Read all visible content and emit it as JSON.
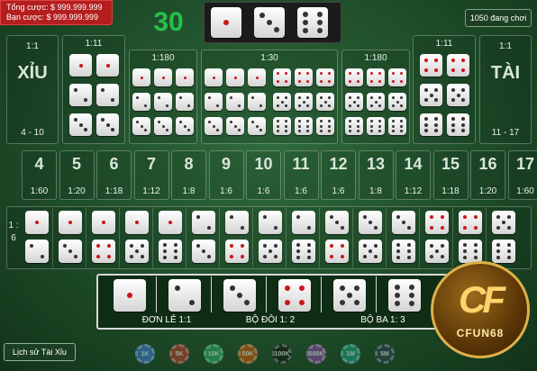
{
  "header": {
    "total_bet_label": "Tổng cược: $ 999.999.999",
    "your_bet_label": "Bạn cược: $ 999.999.999",
    "timer": "30",
    "online": "1050 đang chơi",
    "result_dice": [
      1,
      3,
      6
    ]
  },
  "xiu": {
    "ratio": "1:1",
    "label": "XỈU",
    "range": "4 - 10"
  },
  "tai": {
    "ratio": "1:1",
    "label": "TÀI",
    "range": "11 - 17"
  },
  "pairs_left": {
    "ratio": "1:11",
    "faces": [
      1,
      2,
      3
    ]
  },
  "pairs_right": {
    "ratio": "1:11",
    "faces": [
      4,
      5,
      6
    ]
  },
  "triples_left": {
    "ratio": "1:180",
    "faces": [
      1,
      2,
      3
    ]
  },
  "triples_right": {
    "ratio": "1:180",
    "faces": [
      4,
      5,
      6
    ]
  },
  "any_triple": {
    "ratio": "1:30",
    "faces": [
      1,
      2,
      3,
      4,
      5,
      6
    ]
  },
  "sums": [
    {
      "n": "4",
      "r": "1:60"
    },
    {
      "n": "5",
      "r": "1:20"
    },
    {
      "n": "6",
      "r": "1:18"
    },
    {
      "n": "7",
      "r": "1:12"
    },
    {
      "n": "8",
      "r": "1:8"
    },
    {
      "n": "9",
      "r": "1:6"
    },
    {
      "n": "10",
      "r": "1:6"
    },
    {
      "n": "11",
      "r": "1:6"
    },
    {
      "n": "12",
      "r": "1:6"
    },
    {
      "n": "13",
      "r": "1:8"
    },
    {
      "n": "14",
      "r": "1:12"
    },
    {
      "n": "15",
      "r": "1:18"
    },
    {
      "n": "16",
      "r": "1:20"
    },
    {
      "n": "17",
      "r": "1:60"
    }
  ],
  "combos_label": "1 : 6",
  "combos": [
    [
      1,
      2
    ],
    [
      1,
      3
    ],
    [
      1,
      4
    ],
    [
      1,
      5
    ],
    [
      1,
      6
    ],
    [
      2,
      3
    ],
    [
      2,
      4
    ],
    [
      2,
      5
    ],
    [
      2,
      6
    ],
    [
      3,
      4
    ],
    [
      3,
      5
    ],
    [
      3,
      6
    ],
    [
      4,
      5
    ],
    [
      4,
      6
    ],
    [
      5,
      6
    ]
  ],
  "bet_types": {
    "faces": [
      1,
      2,
      3,
      4,
      5,
      6
    ],
    "single": "ĐƠN LẺ 1:1",
    "pair": "BỘ ĐÔI 1: 2",
    "triple": "BỘ BA 1: 3"
  },
  "footer": {
    "history": "Lịch sử Tài Xỉu",
    "chips": [
      {
        "label": "1K",
        "color": "#3a7bd5"
      },
      {
        "label": "5K",
        "color": "#c0392b"
      },
      {
        "label": "10K",
        "color": "#27ae60"
      },
      {
        "label": "50K",
        "color": "#d35400"
      },
      {
        "label": "100K",
        "color": "#111111"
      },
      {
        "label": "500K",
        "color": "#8e44ad"
      },
      {
        "label": "1M",
        "color": "#16a085"
      },
      {
        "label": "5M",
        "color": "#2c3e50"
      }
    ]
  },
  "logo": {
    "mark": "CF",
    "text": "CFUN68"
  }
}
